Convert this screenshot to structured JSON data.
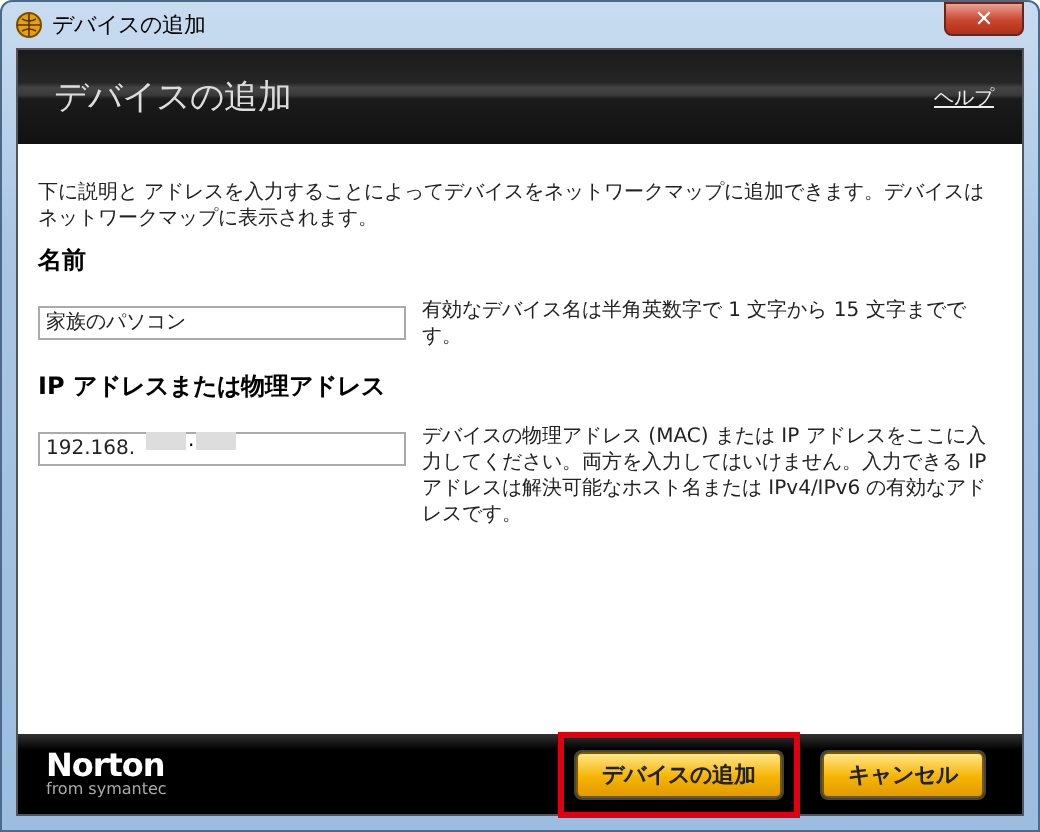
{
  "window": {
    "title": "デバイスの追加",
    "close": "✕"
  },
  "header": {
    "title": "デバイスの追加",
    "help_link": "ヘルプ"
  },
  "description": "下に説明と アドレスを入力することによってデバイスをネットワークマップに追加できます。デバイスはネットワークマップに表示されます。",
  "fields": [
    {
      "label": "名前",
      "value": "家族のパソコン",
      "hint": "有効なデバイス名は半角英数字で 1 文字から 15 文字までです。"
    },
    {
      "label": "IP アドレスまたは物理アドレス",
      "value": "192.168.",
      "separator": ".",
      "hint": "デバイスの物理アドレス (MAC) または IP アドレスをここに入力してください。両方を入力してはいけません。入力できる IP アドレスは解決可能なホスト名または IPv4/IPv6 の有効なアドレスです。"
    }
  ],
  "footer": {
    "logo": "Norton",
    "logo_sub": "from symantec"
  },
  "buttons": [
    {
      "label": "デバイスの追加",
      "highlighted": true
    },
    {
      "label": "キャンセル",
      "highlighted": false
    }
  ]
}
